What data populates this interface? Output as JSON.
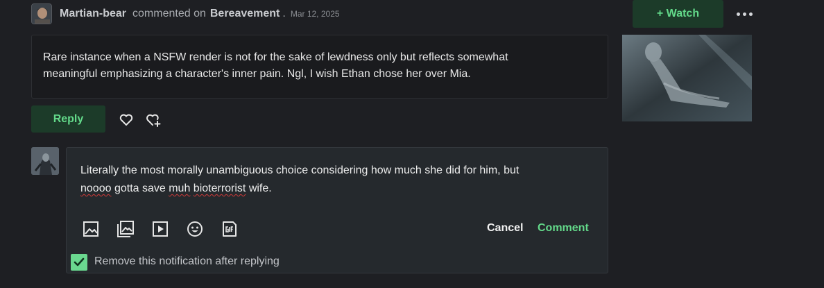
{
  "header": {
    "username": "Martian-bear",
    "action": "commented on",
    "target": "Bereavement",
    "separator": ".",
    "date": "Mar 12, 2025"
  },
  "watch_label": "+ Watch",
  "more_icon": "more-horizontal-icon",
  "comment": {
    "text_line1": "Rare instance when a NSFW render is not for the sake of lewdness only but reflects somewhat",
    "text_line2": "meaningful emphasizing a character's inner pain. Ngl, I wish Ethan chose her over Mia."
  },
  "reply_label": "Reply",
  "like_icon": "heart-icon",
  "save_icon": "favorite-add-icon",
  "editor": {
    "line1": "Literally the most morally unambiguous choice considering how much she did for him, but",
    "line2_misspelled_1": "noooo",
    "line2_mid": " gotta save ",
    "line2_misspelled_2": "muh",
    "line2_space": " ",
    "line2_misspelled_3": "bioterrorist",
    "line2_end": " wife.",
    "toolbar_icons": [
      "image-icon",
      "gallery-icon",
      "video-icon",
      "emoji-icon",
      "gif-icon"
    ],
    "cancel_label": "Cancel",
    "submit_label": "Comment"
  },
  "remove_notification": {
    "checked": true,
    "label": "Remove this notification after replying"
  },
  "colors": {
    "accent_green": "#63d98a",
    "button_green_bg": "#1c3b29",
    "background": "#1e1f23",
    "editor_bg": "#25292d"
  }
}
